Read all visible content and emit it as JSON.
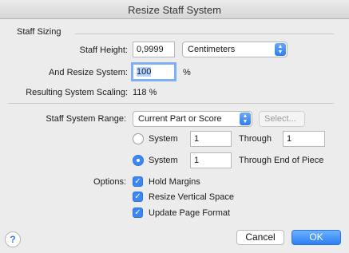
{
  "window": {
    "title": "Resize Staff System"
  },
  "staff_sizing": {
    "section_label": "Staff Sizing",
    "height_label": "Staff Height:",
    "height_value": "0,9999",
    "unit_selected": "Centimeters",
    "resize_label": "And Resize System:",
    "resize_value": "100",
    "percent_symbol": "%",
    "result_label": "Resulting System Scaling:",
    "result_value": "118 %"
  },
  "range": {
    "label": "Staff System Range:",
    "selected": "Current Part or Score",
    "select_button": "Select...",
    "option1_label": "System",
    "option1_from": "1",
    "through_label": "Through",
    "option1_to": "1",
    "option2_label": "System",
    "option2_from": "1",
    "through_end_label": "Through End of Piece",
    "selected_option": 2
  },
  "options": {
    "label": "Options:",
    "hold_margins": "Hold Margins",
    "resize_vertical": "Resize Vertical Space",
    "update_page": "Update Page Format"
  },
  "buttons": {
    "help": "?",
    "cancel": "Cancel",
    "ok": "OK"
  }
}
